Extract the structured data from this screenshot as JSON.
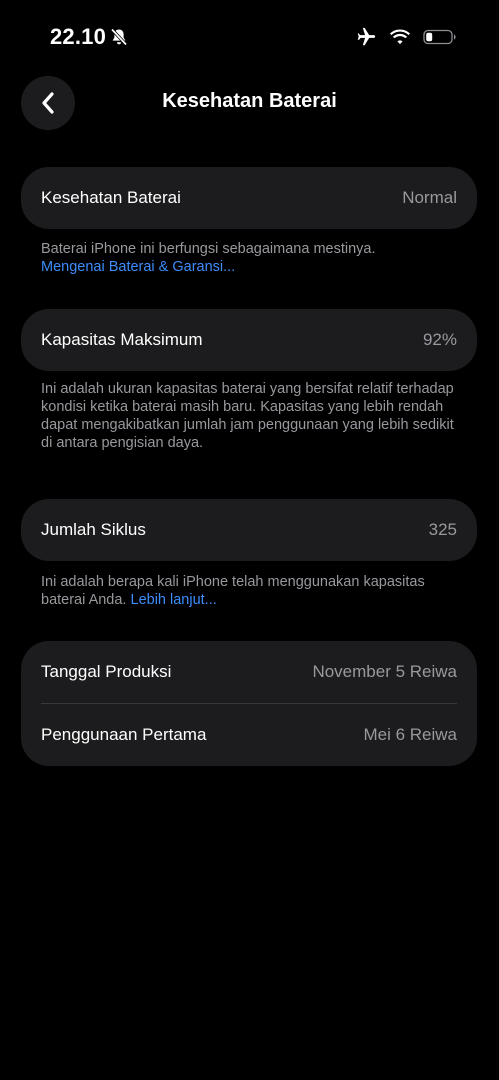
{
  "status_bar": {
    "time": "22.10"
  },
  "nav": {
    "title": "Kesehatan Baterai"
  },
  "battery_health": {
    "label": "Kesehatan Baterai",
    "value": "Normal",
    "footnote": "Baterai iPhone ini berfungsi sebagaimana mestinya.",
    "link": "Mengenai Baterai & Garansi..."
  },
  "max_capacity": {
    "label": "Kapasitas Maksimum",
    "value": "92%",
    "footnote": "Ini adalah ukuran kapasitas baterai yang bersifat relatif terhadap kondisi ketika baterai masih baru. Kapasitas yang lebih rendah dapat mengakibatkan jumlah jam penggunaan yang lebih sedikit di antara pengisian daya."
  },
  "cycle_count": {
    "label": "Jumlah Siklus",
    "value": "325",
    "footnote": "Ini adalah berapa kali iPhone telah menggunakan kapasitas baterai Anda.",
    "link": "Lebih lanjut..."
  },
  "dates": {
    "manufacture_label": "Tanggal Produksi",
    "manufacture_value": "November 5 Reiwa",
    "first_use_label": "Penggunaan Pertama",
    "first_use_value": "Mei 6 Reiwa"
  },
  "colors": {
    "background": "#000000",
    "card": "#1c1c1e",
    "secondary_text": "#98989e",
    "link": "#3d8dfc"
  }
}
